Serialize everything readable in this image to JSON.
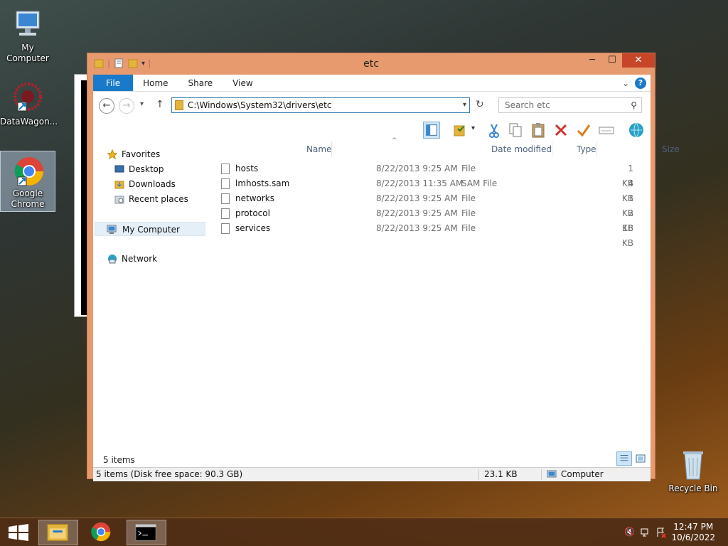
{
  "desktop": {
    "icons": [
      {
        "label": "My Computer"
      },
      {
        "label": "DataWagon..."
      },
      {
        "label": "Google Chrome"
      },
      {
        "label": "Recycle Bin"
      }
    ]
  },
  "window": {
    "title": "etc",
    "controls": {
      "minimize": "─",
      "maximize": "☐",
      "close": "✕"
    }
  },
  "ribbon": {
    "tabs": [
      "File",
      "Home",
      "Share",
      "View"
    ],
    "expand": "⌄",
    "help": "?"
  },
  "address_bar": {
    "path": "C:\\Windows\\System32\\drivers\\etc",
    "search_placeholder": "Search etc",
    "back": "←",
    "forward": "→",
    "recent": "▾",
    "up": "↑",
    "refresh": "↻",
    "dropdown": "▾",
    "search_icon": "⚲"
  },
  "nav_pane": {
    "favorites": "Favorites",
    "items": [
      "Desktop",
      "Downloads",
      "Recent places"
    ],
    "my_computer": "My Computer",
    "network": "Network"
  },
  "file_list": {
    "columns": [
      "Name",
      "Date modified",
      "Type",
      "Size"
    ],
    "rows": [
      {
        "name": "hosts",
        "date": "8/22/2013 9:25 AM",
        "type": "File",
        "size": "1 KB"
      },
      {
        "name": "lmhosts.sam",
        "date": "8/22/2013 11:35 AM",
        "type": "SAM File",
        "size": "4 KB"
      },
      {
        "name": "networks",
        "date": "8/22/2013 9:25 AM",
        "type": "File",
        "size": "1 KB"
      },
      {
        "name": "protocol",
        "date": "8/22/2013 9:25 AM",
        "type": "File",
        "size": "2 KB"
      },
      {
        "name": "services",
        "date": "8/22/2013 9:25 AM",
        "type": "File",
        "size": "18 KB"
      }
    ]
  },
  "status": {
    "item_count": "5 items",
    "disk_info": "5 items (Disk free space: 90.3 GB)",
    "size_total": "23.1 KB",
    "location": "Computer"
  },
  "taskbar": {
    "time": "12:47 PM",
    "date": "10/6/2022"
  },
  "colors": {
    "accent": "#1979ca",
    "window_frame": "#e79a6e",
    "close_button": "#c7462a"
  }
}
